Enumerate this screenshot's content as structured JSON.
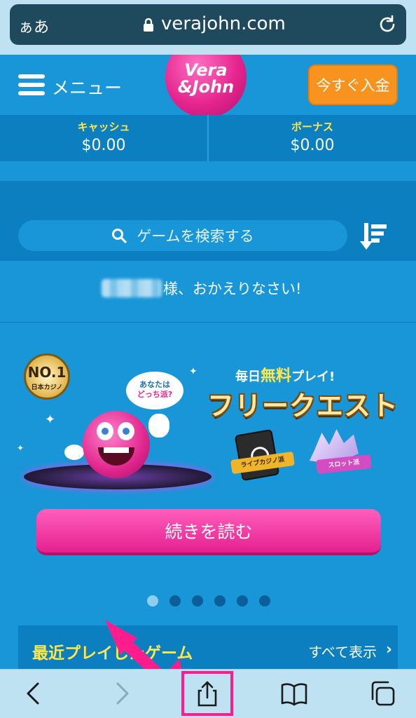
{
  "browser": {
    "text_size_label": "ぁあ",
    "domain": "verajohn.com"
  },
  "header": {
    "menu_label": "メニュー",
    "logo_text_line1": "Vera",
    "logo_text_line2": "&John",
    "deposit_label": "今すぐ入金"
  },
  "balances": {
    "cash_label": "キャッシュ",
    "cash_value": "$0.00",
    "bonus_label": "ボーナス",
    "bonus_value": "$0.00"
  },
  "search": {
    "placeholder": "ゲームを検索する"
  },
  "welcome": {
    "text": "様、おかえりなさい!"
  },
  "banner": {
    "badge_no": "NO.1",
    "badge_sub": "日本カジノ",
    "bubble_line1": "あなたは",
    "bubble_line2": "どっち派?",
    "promo_prefix": "毎日",
    "promo_free": "無料",
    "promo_suffix": "プレイ!",
    "promo_title": "フリークエスト",
    "ribbon_live": "ライブカジノ派",
    "ribbon_slot": "スロット派"
  },
  "continue_button": "続きを読む",
  "pagination": {
    "total": 6,
    "active_index": 0
  },
  "recent": {
    "title": "最近プレイしたゲーム",
    "view_all": "すべて表示",
    "chevron": "›"
  },
  "colors": {
    "page_bg": "#1896d8",
    "dark_band": "#0b7fbf",
    "deposit_orange": "#f7931e",
    "pink_button": "#e5208f",
    "yellow_label": "#ffe84a",
    "highlight": "#ff1d8e"
  },
  "icons": {
    "lock": "lock-icon",
    "reload": "reload-icon",
    "menu": "hamburger-icon",
    "search": "search-icon",
    "sort": "sort-icon",
    "back": "back-icon",
    "forward": "forward-icon",
    "share": "share-icon",
    "bookmarks": "bookmarks-icon",
    "tabs": "tabs-icon"
  }
}
